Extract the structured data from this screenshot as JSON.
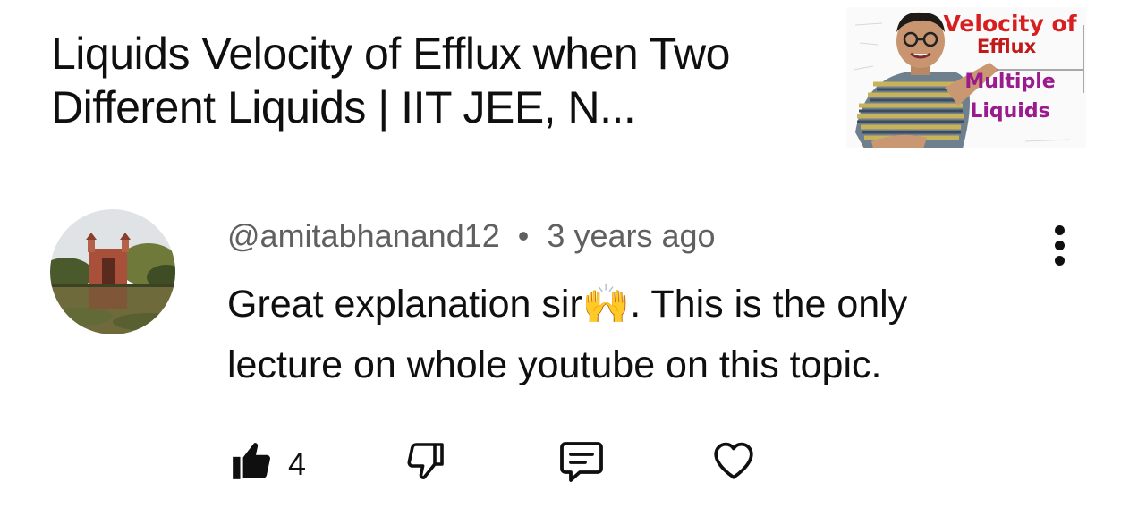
{
  "video": {
    "title": "Liquids Velocity of Efflux when Two Different Liquids | IIT JEE, N...",
    "thumbnail_text": {
      "line1": "Velocity of",
      "line2": "Efflux",
      "line3": "Multiple",
      "line4": "Liquids"
    }
  },
  "comment": {
    "author": "@amitabhanand12",
    "separator": "•",
    "time": "3 years ago",
    "text": "Great explanation sir🙌. This is the only lecture on whole youtube on this topic.",
    "like_count": "4"
  },
  "icons": {
    "like": "thumbs-up-icon",
    "dislike": "thumbs-down-icon",
    "reply": "reply-comment-icon",
    "heart": "heart-icon",
    "more": "more-vertical-icon"
  },
  "colors": {
    "text": "#0f0f0f",
    "secondary": "#606060",
    "thumb_red": "#d81f1f",
    "thumb_purple": "#9a1b8d"
  }
}
